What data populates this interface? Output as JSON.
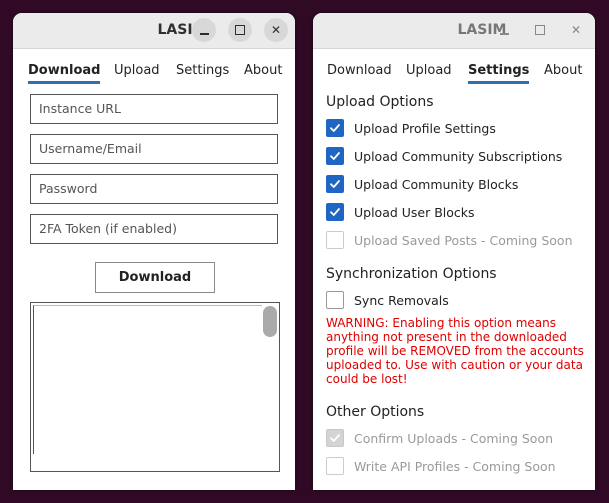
{
  "left_window": {
    "title": "LASIM",
    "tabs": [
      "Download",
      "Upload",
      "Settings",
      "About"
    ],
    "active_tab": "Download",
    "fields": [
      {
        "placeholder": "Instance URL"
      },
      {
        "placeholder": "Username/Email"
      },
      {
        "placeholder": "Password"
      },
      {
        "placeholder": "2FA Token (if enabled)"
      }
    ],
    "download_button": "Download"
  },
  "right_window": {
    "title": "LASIM",
    "tabs": [
      "Download",
      "Upload",
      "Settings",
      "About"
    ],
    "active_tab": "Settings",
    "upload_options": {
      "heading": "Upload Options",
      "items": [
        {
          "label": "Upload Profile Settings",
          "state": "checked"
        },
        {
          "label": "Upload Community Subscriptions",
          "state": "checked"
        },
        {
          "label": "Upload Community Blocks",
          "state": "checked"
        },
        {
          "label": "Upload User Blocks",
          "state": "checked"
        },
        {
          "label": "Upload Saved Posts - Coming Soon",
          "state": "disabled"
        }
      ]
    },
    "sync_options": {
      "heading": "Synchronization Options",
      "items": [
        {
          "label": "Sync Removals",
          "state": "unchecked"
        }
      ],
      "warning": "WARNING: Enabling this option means anything not present in the downloaded profile will be REMOVED from the accounts uploaded to. Use with caution or your data could be lost!"
    },
    "other_options": {
      "heading": "Other Options",
      "items": [
        {
          "label": "Confirm Uploads - Coming Soon",
          "state": "checked-disabled"
        },
        {
          "label": "Write API Profiles - Coming Soon",
          "state": "disabled"
        }
      ]
    }
  },
  "colors": {
    "background": "#300a24",
    "accent": "#1f66c4",
    "tab_underline": "#2f6fb3",
    "warning": "#e00000"
  }
}
